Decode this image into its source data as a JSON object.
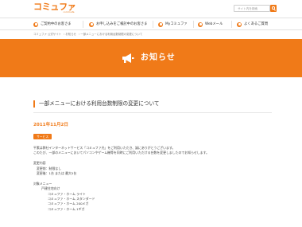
{
  "header": {
    "logo_text": "コミュファ",
    "logo_sub": "commufa",
    "search_placeholder": "サイト内を検索"
  },
  "nav": {
    "items": [
      {
        "label": "ご契約中のお客さま"
      },
      {
        "label": "お申し込みをご検討中のお客さま"
      },
      {
        "label": "Myコミュファ"
      },
      {
        "label": "Webメール"
      },
      {
        "label": "よくあるご質問"
      }
    ]
  },
  "breadcrumb": [
    "コミュファ 公式サイト",
    "お知らせ",
    "一部メニューにおける利用台数制限の変更について"
  ],
  "banner": {
    "title": "お知らせ"
  },
  "article": {
    "title": "一部メニューにおける利用台数制限の変更について",
    "date": "2011年11月2日",
    "tag": "サービス",
    "lines": [
      "平素は弊社インターネットサービス「コミュファ光」をご利用いただき、誠にありがとうございます。",
      "このたび、一部のメニューにおいてパソコンやゲーム機等を同時にご利用いただける台数を変更しましたのでお知らせします。",
      "",
      "変更内容",
      "変更前：制限なし",
      "変更後：1台 または 最大5台",
      "",
      "対象メニュー",
      "戸建住宅向け",
      "コミュファ・ホーム ライト",
      "コミュファ・ホーム スタンダード",
      "コミュファ・ホーム 200メガ",
      "コミュファ・ホーム 1ギガ"
    ]
  },
  "colors": {
    "accent": "#f07a18"
  }
}
